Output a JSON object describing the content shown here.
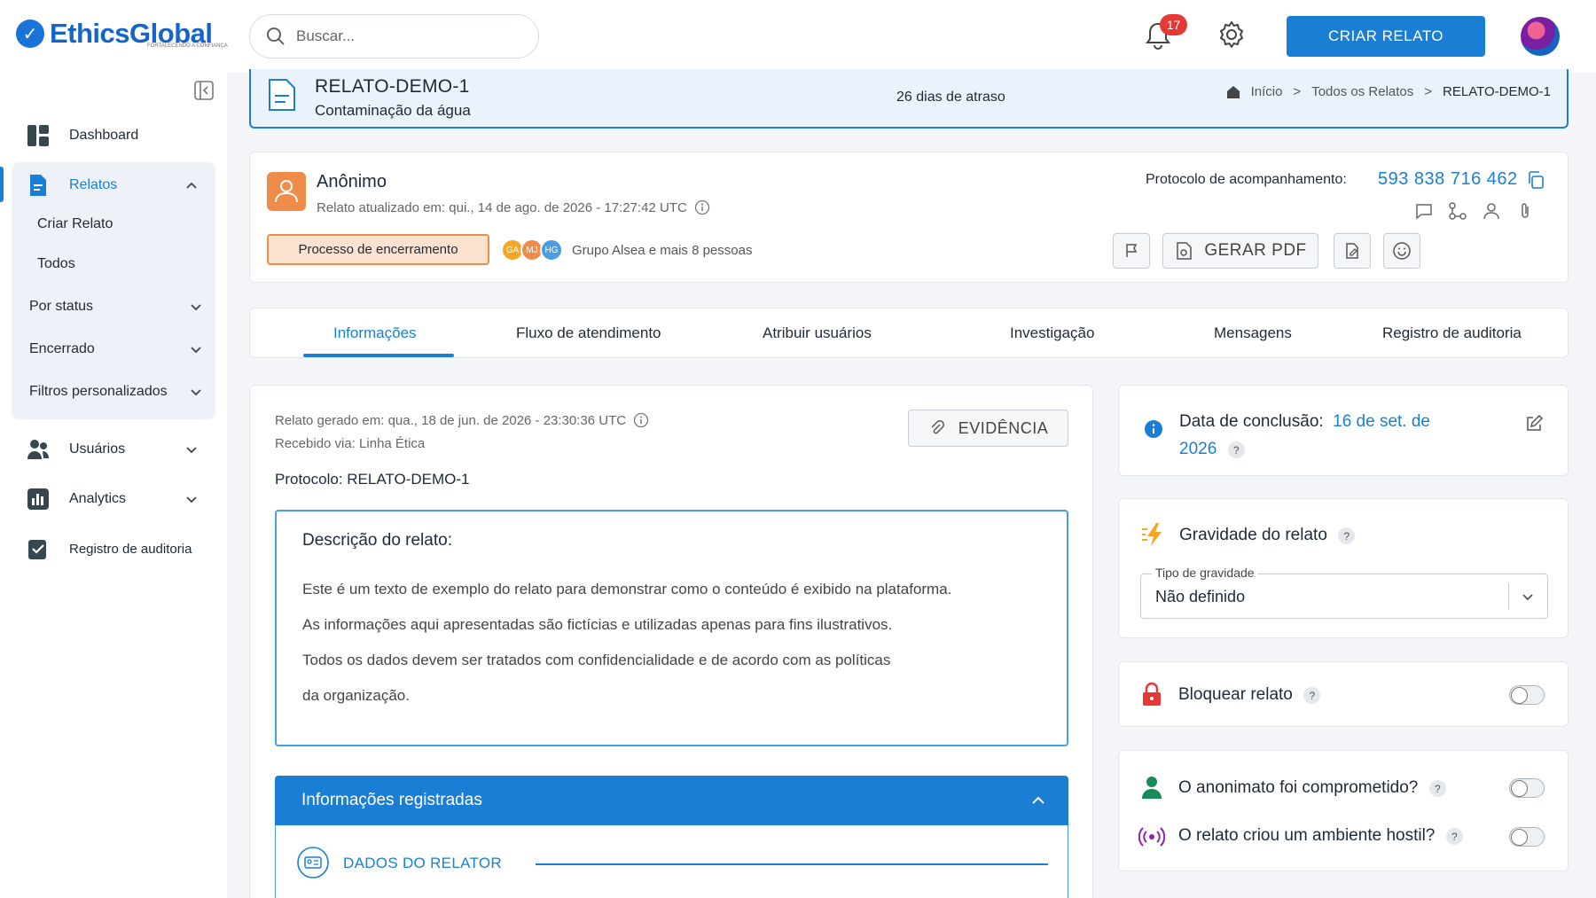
{
  "app": {
    "brand": "EthicsGlobal",
    "tagline": "FORTALECENDO A CONFIANÇA",
    "search_placeholder": "Buscar...",
    "notifications_count": "17",
    "create_button": "CRIAR RELATO"
  },
  "sidebar": {
    "dashboard": "Dashboard",
    "relatos": "Relatos",
    "criar_relato": "Criar Relato",
    "todos": "Todos",
    "por_status": "Por status",
    "encerrado": "Encerrado",
    "filtros": "Filtros personalizados",
    "usuarios": "Usuários",
    "analytics": "Analytics",
    "registro": "Registro de auditoria"
  },
  "header": {
    "title": "RELATO-DEMO-1",
    "subtitle": "Contaminação da água",
    "late": "26 dias de atraso",
    "breadcrumb": [
      "Início",
      "Todos os Relatos",
      "RELATO-DEMO-1"
    ]
  },
  "reporter": {
    "name": "Anônimo",
    "updated": "Relato atualizado em: qui., 14 de ago. de 2026 - 17:27:42 UTC",
    "status_chip": "Processo de encerramento",
    "members": [
      "GA",
      "MJ",
      "HG"
    ],
    "group_text": "Grupo Alsea e mais 8 pessoas",
    "protocol_label": "Protocolo de acompanhamento:",
    "protocol_value": "593 838 716 462",
    "pdf_button": "GERAR PDF"
  },
  "tabs": [
    "Informações",
    "Fluxo de atendimento",
    "Atribuir usuários",
    "Investigação",
    "Mensagens",
    "Registro de auditoria"
  ],
  "main": {
    "generated": "Relato gerado em: qua., 18 de jun. de 2026 - 23:30:36 UTC",
    "received": "Recebido via: Linha Ética",
    "protocol": "Protocolo: RELATO-DEMO-1",
    "evidence_button": "EVIDÊNCIA",
    "desc_title": "Descrição do relato:",
    "desc_lines": [
      "Este é um texto de exemplo do relato para demonstrar como o conteúdo é exibido na plataforma.",
      "As informações aqui apresentadas são fictícias e utilizadas apenas para fins ilustrativos.",
      "Todos os dados devem ser tratados com confidencialidade e de acordo com as políticas",
      "da organização."
    ],
    "info_title": "Informações registradas",
    "dados_label": "DADOS DO RELATOR"
  },
  "side": {
    "conclusion_label": "Data de conclusão:",
    "conclusion_date_1": "16 de set. de",
    "conclusion_date_2": "2026",
    "severity_title": "Gravidade do relato",
    "severity_field_label": "Tipo de gravidade",
    "severity_value": "Não definido",
    "lock_label": "Bloquear relato",
    "anon_label": "O anonimato foi comprometido?",
    "hostile_label": "O relato criou um ambiente hostil?",
    "help_mark": "?"
  },
  "colors": {
    "primary": "#1a7fd4",
    "status_chip_bg": "#fde3cf",
    "status_chip_border": "#f08c4a",
    "badge": "#e53935"
  }
}
